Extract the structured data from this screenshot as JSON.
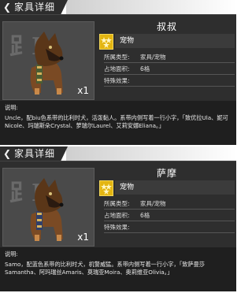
{
  "cards": [
    {
      "header_title": "家具详细",
      "name": "叔叔",
      "category": "宠物",
      "quantity": "x1",
      "attributes": [
        {
          "key": "所属类型:",
          "value": "家具/宠物"
        },
        {
          "key": "占地面积:",
          "value": "6格"
        },
        {
          "key": "特殊效果:",
          "value": ""
        }
      ],
      "desc_label": "说明:",
      "desc_text": "Uncle，配biu色系带的比利时犬，活泼黏人。系带内侧写着一行小字，「致优拉Ula、妮可Nicole、玛瑞斯朵Crystal、萝瑞尔Laurel、艾莉安娜Eliana。」",
      "colors": {
        "stars": "#e3b511",
        "panel": "#2e2e2e"
      },
      "icon": "star-icon"
    },
    {
      "header_title": "家具详细",
      "name": "萨摩",
      "category": "宠物",
      "quantity": "x1",
      "attributes": [
        {
          "key": "所属类型:",
          "value": "家具/宠物"
        },
        {
          "key": "占地面积:",
          "value": "6格"
        },
        {
          "key": "特殊效果:",
          "value": ""
        }
      ],
      "desc_label": "说明:",
      "desc_text": "Samo，配蓝色系带的比利时犬，机警威猛。系带内侧写着一行小字，「致萨曼莎Samantha、阿玛瑞丝Amaris、莫瑞亚Moira、奥莉维亚Olivia。」",
      "colors": {
        "stars": "#e3b511",
        "panel": "#2e2e2e"
      },
      "icon": "star-icon"
    }
  ]
}
